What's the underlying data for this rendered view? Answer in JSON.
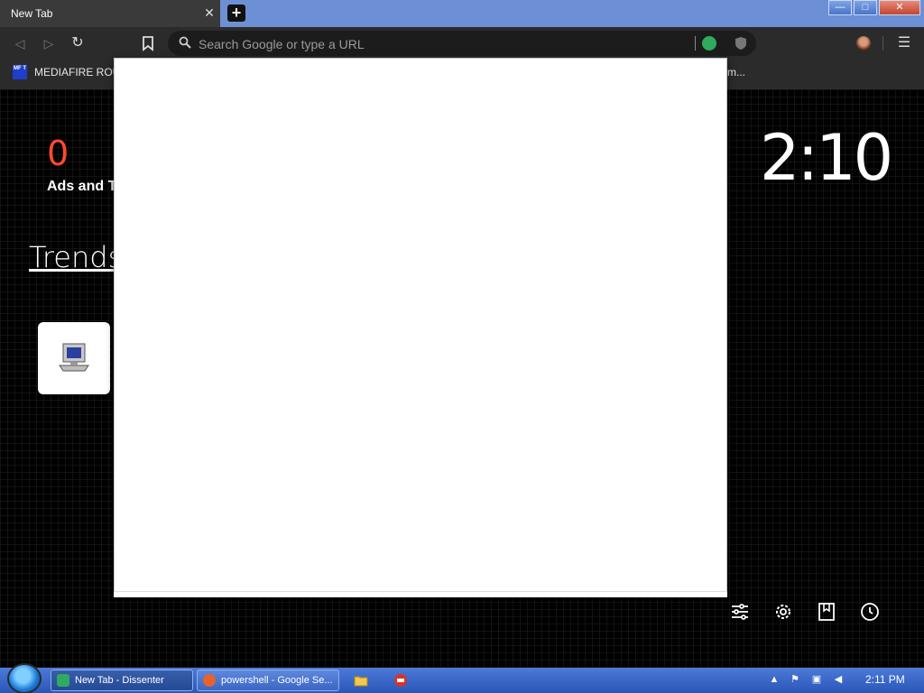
{
  "tab": {
    "title": "New Tab"
  },
  "window_controls": {
    "minimize": "—",
    "maximize": "□",
    "close": "✕"
  },
  "omnibox": {
    "placeholder": "Search Google or type a URL"
  },
  "bookmarks": {
    "items": [
      {
        "label": "MEDIAFIRE ROU",
        "favicon_text": "MF T"
      }
    ],
    "overflow": "m..."
  },
  "newtab_page": {
    "ads_count": "0",
    "ads_label": "Ads and T",
    "clock": "2:10",
    "trends_heading": "Trends"
  },
  "taskbar": {
    "buttons": [
      {
        "label": "New Tab - Dissenter",
        "icon_color": "#2faa5e"
      },
      {
        "label": "powershell - Google Se...",
        "icon_color": "#e8622a"
      }
    ],
    "time": "2:11 PM"
  }
}
